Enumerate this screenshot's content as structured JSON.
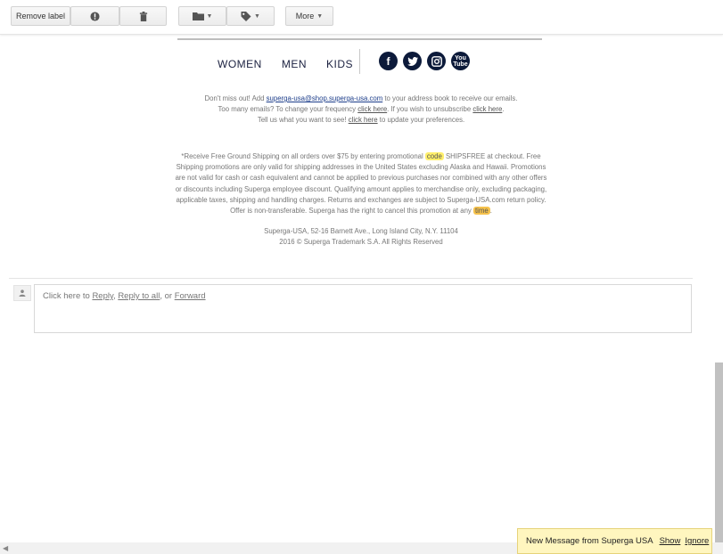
{
  "toolbar": {
    "remove_label": "Remove label",
    "report_spam_icon": "exclamation-circle-icon",
    "delete_icon": "trash-icon",
    "move_icon": "folder-icon",
    "labels_icon": "tag-icon",
    "more_label": "More"
  },
  "email": {
    "nav": [
      "WOMEN",
      "MEN",
      "KIDS"
    ],
    "social": [
      "facebook-icon",
      "twitter-icon",
      "instagram-icon",
      "youtube-icon"
    ],
    "social_labels": {
      "facebook": "f",
      "twitter": "t",
      "youtube": "You Tube"
    },
    "addressbook": {
      "line1_pre": "Don't miss out! Add ",
      "email": "superga-usa@shop.superga-usa.com",
      "line1_post": " to your address book to receive our emails.",
      "line2_pre": "Too many emails? To change your frequency ",
      "click_here": "click here",
      "line2_mid": ". If you wish to unsubscribe ",
      "line2_post": ".",
      "line3_pre": "Tell us what you want to see! ",
      "line3_post": " to update your preferences."
    },
    "promo": {
      "pre": "*Receive Free Ground Shipping on all orders over $75 by entering promotional ",
      "hl1": "code",
      "mid": " SHIPSFREE at checkout. Free Shipping promotions are only valid for shipping addresses in the United States excluding Alaska and Hawaii. Promotions are not valid for cash or cash equivalent and cannot be applied to previous purchases nor combined with any other offers or discounts including Superga employee discount. Qualifying amount applies to merchandise only, excluding packaging, applicable taxes, shipping and handling charges. Returns and exchanges are subject to Superga-USA.com return policy. Offer is non-transferable. Superga has the right to cancel this promotion at any ",
      "hl2": "time",
      "post": "."
    },
    "footer": {
      "address": "Superga-USA, 52-16 Barnett Ave., Long Island City, N.Y. 11104",
      "copyright": "2016 © Superga Trademark S.A. All Rights Reserved"
    }
  },
  "reply": {
    "pre": "Click here to ",
    "reply": "Reply",
    "sep1": ", ",
    "reply_all": "Reply to all",
    "sep2": ", or ",
    "forward": "Forward"
  },
  "notification": {
    "text": "New Message from Superga USA",
    "show": "Show",
    "ignore": "Ignore",
    "bg_color": "#fff6bf"
  }
}
